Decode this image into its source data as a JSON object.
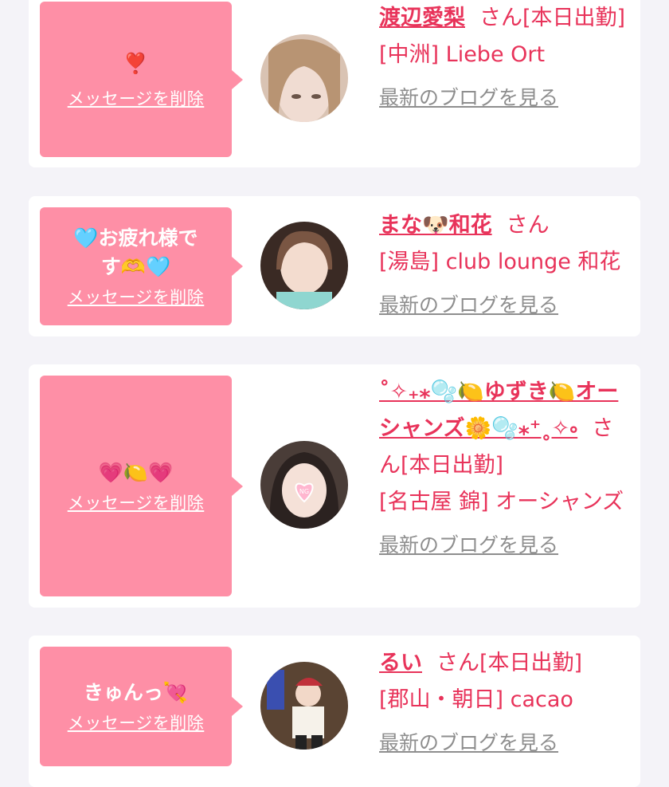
{
  "delete_label": "メッセージを削除",
  "colors": {
    "bubble": "#fe8fa6",
    "accent": "#e8335a",
    "muted": "#8e8e8e",
    "background": "#f4f3f8"
  },
  "cards": [
    {
      "message": "❣️",
      "name": "渡辺愛梨",
      "honorific": "さん",
      "status": "[本日出勤]",
      "shop": "[中洲] Liebe Ort",
      "blog_link": "最新のブログを見る"
    },
    {
      "message": "🩵お疲れ様です🫶🩵",
      "name": "まな🐶和花",
      "honorific": "さん",
      "status": "",
      "shop": "[湯島] club lounge 和花",
      "blog_link": "最新のブログを見る"
    },
    {
      "message": "💗🍋💗",
      "name": "˚✧₊⁎🫧🍋ゆずき🍋オーシャンズ🌼🫧⁎⁺˳✧༚",
      "honorific": "さん",
      "status": "[本日出勤]",
      "shop": "[名古屋 錦] オーシャンズ",
      "blog_link": "最新のブログを見る"
    },
    {
      "message": "きゅんっ💘",
      "name": "るい",
      "honorific": "さん",
      "status": "[本日出勤]",
      "shop": "[郡山・朝日] cacao",
      "blog_link": "最新のブログを見る"
    }
  ]
}
